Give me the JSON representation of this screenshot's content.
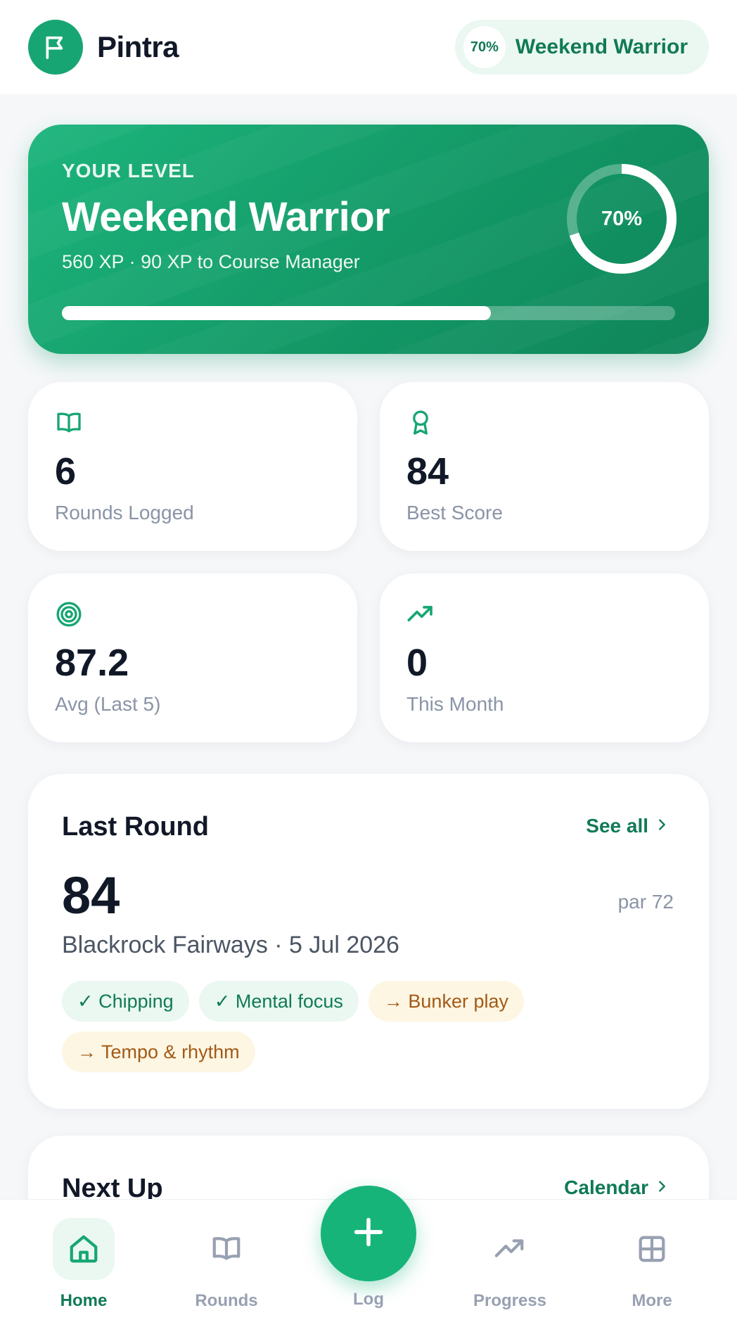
{
  "header": {
    "brand": "Pintra",
    "level_pill_pct": "70%",
    "level_pill_name": "Weekend Warrior"
  },
  "level_card": {
    "eyebrow": "YOUR LEVEL",
    "title": "Weekend Warrior",
    "subtitle": "560 XP · 90 XP to Course Manager",
    "ring_label": "70%",
    "progress_fraction": 0.7
  },
  "stats": [
    {
      "icon": "book-icon",
      "value": "6",
      "label": "Rounds Logged"
    },
    {
      "icon": "award-icon",
      "value": "84",
      "label": "Best Score"
    },
    {
      "icon": "target-icon",
      "value": "87.2",
      "label": "Avg (Last 5)"
    },
    {
      "icon": "trending-up-icon",
      "value": "0",
      "label": "This Month"
    }
  ],
  "last_round": {
    "title": "Last Round",
    "see_all": "See all",
    "score": "84",
    "par": "par 72",
    "course": "Blackrock Fairways · 5 Jul 2026",
    "chips": [
      {
        "text": "✓ Chipping",
        "type": "good"
      },
      {
        "text": "✓ Mental focus",
        "type": "good"
      },
      {
        "text": "→ Bunker play",
        "type": "work"
      },
      {
        "text": "→ Tempo & rhythm",
        "type": "work"
      }
    ]
  },
  "next_up": {
    "title": "Next Up",
    "link": "Calendar"
  },
  "nav": {
    "home": "Home",
    "rounds": "Rounds",
    "log": "Log",
    "progress": "Progress",
    "more": "More"
  },
  "colors": {
    "brand": "#17a673",
    "brand_dark": "#117a55",
    "warn_text": "#a25a16"
  }
}
